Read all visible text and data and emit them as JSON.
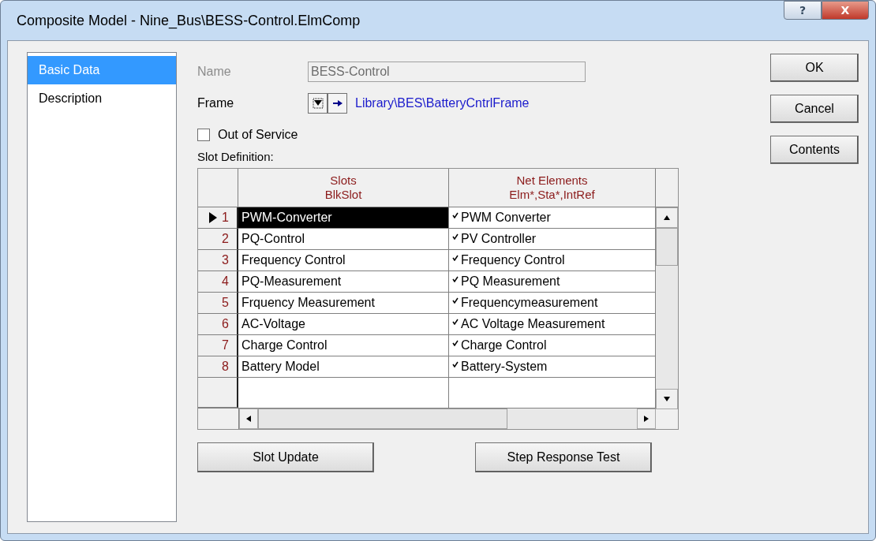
{
  "window": {
    "title": "Composite Model - Nine_Bus\\BESS-Control.ElmComp",
    "help_glyph": "?",
    "close_glyph": "X"
  },
  "sidebar": {
    "items": [
      {
        "label": "Basic Data",
        "selected": true
      },
      {
        "label": "Description",
        "selected": false
      }
    ]
  },
  "form": {
    "name_label": "Name",
    "name_value": "BESS-Control",
    "name_disabled": true,
    "frame_label": "Frame",
    "frame_link": "Library\\BES\\BatteryCntrlFrame",
    "out_of_service": {
      "label": "Out of Service",
      "checked": false
    },
    "slot_definition_label": "Slot Definition:"
  },
  "table": {
    "columns": [
      {
        "title": "Slots",
        "subtitle": "BlkSlot"
      },
      {
        "title": "Net Elements",
        "subtitle": "Elm*,Sta*,IntRef"
      }
    ],
    "rows": [
      {
        "number": "1",
        "slot": "PWM-Converter",
        "element": "PWM Converter",
        "checked": true,
        "selected": true
      },
      {
        "number": "2",
        "slot": "PQ-Control",
        "element": "PV Controller",
        "checked": true,
        "selected": false
      },
      {
        "number": "3",
        "slot": "Frequency Control",
        "element": "Frequency Control",
        "checked": true,
        "selected": false
      },
      {
        "number": "4",
        "slot": "PQ-Measurement",
        "element": "PQ Measurement",
        "checked": true,
        "selected": false
      },
      {
        "number": "5",
        "slot": "Frquency Measurement",
        "element": "Frequencymeasurement",
        "checked": true,
        "selected": false
      },
      {
        "number": "6",
        "slot": "AC-Voltage",
        "element": "AC Voltage Measurement",
        "checked": true,
        "selected": false
      },
      {
        "number": "7",
        "slot": "Charge Control",
        "element": "Charge Control",
        "checked": true,
        "selected": false
      },
      {
        "number": "8",
        "slot": "Battery Model",
        "element": "Battery-System",
        "checked": true,
        "selected": false
      }
    ]
  },
  "bottom_buttons": [
    "Slot Update",
    "Step Response Test"
  ],
  "side_buttons": [
    "OK",
    "Cancel",
    "Contents"
  ]
}
